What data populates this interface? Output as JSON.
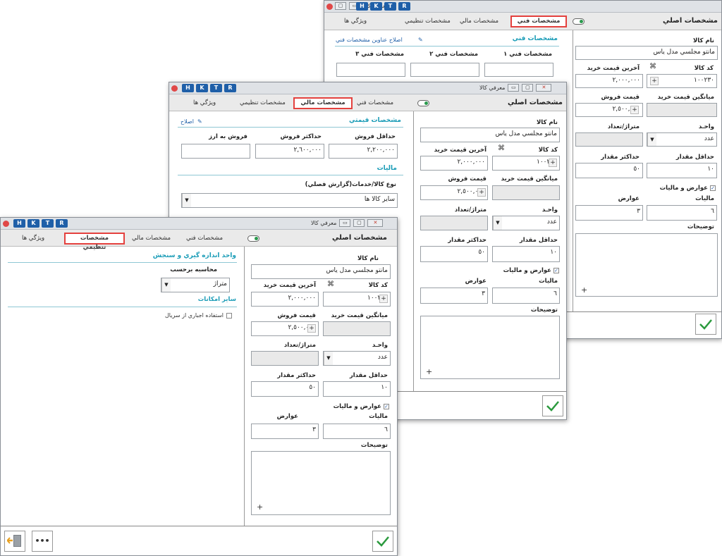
{
  "keys": [
    "H",
    "K",
    "T",
    "R"
  ],
  "title": "معرفي كالا",
  "close_glyph": "✕",
  "min_glyph": "▭",
  "max_glyph": "▢",
  "tabs": {
    "features": "ويژگي ها",
    "setup": "مشخصات تنظيمي",
    "financial": "مشخصات مالي",
    "technical": "مشخصات فني"
  },
  "main": {
    "header": "مشخصات اصلي",
    "name_label": "نام كالا",
    "name_value": "مانتو مجلسي مدل ياس",
    "code_label": "كد كالا",
    "code_value": "١٠٠٢٣٠",
    "code_icon": "⌘",
    "last_buy_label": "آخرين قيمت خريد",
    "last_buy_value": "٢,٠٠٠,٠٠٠",
    "avg_buy_label": "ميانگين قيمت خريد",
    "sell_label": "قيمت فروش",
    "sell_value": "٢,٥٠٠,٠٠٠",
    "unit_label": "واحـد",
    "unit_value": "عدد",
    "meter_label": "متراژ/تعداد",
    "min_label": "حداقل مقدار",
    "min_value": "١٠",
    "max_label": "حداكثر مقدار",
    "max_value": "٥٠",
    "tax_check": "عوارض و ماليات",
    "tax_label": "ماليات",
    "tax_value": "٦",
    "duty_label": "عوارض",
    "duty_value": "٣",
    "desc_label": "توضيحات",
    "plus": "+",
    "arrow": "▼",
    "check": "✓"
  },
  "technical": {
    "section": "مشخصات فني",
    "edit_titles": "اصلاح عناوين مشخصات فني",
    "spec1": "مشخصات فني ١",
    "spec2": "مشخصات فني ٢",
    "spec3": "مشخصات فني ٣"
  },
  "financial": {
    "section": "مشخصات قيمتي",
    "edit": "اصلاح",
    "min_sell_label": "حداقل فروش",
    "min_sell_value": "٢,٢٠٠,٠٠٠",
    "max_sell_label": "حداكثر فروش",
    "max_sell_value": "٢,٦٠٠,٠٠٠",
    "fx_label": "فروش به ارز",
    "tax_section": "ماليات",
    "goods_type_label": "نوع كالا/خدمات(گزارش فصلي)",
    "goods_type_value": "ساير كالا ها"
  },
  "setup": {
    "section": "واحد اندازه گيري و سنجش",
    "calc_label": "محاسبه برحسب",
    "calc_value": "متراژ",
    "other_section": "ساير امكانات",
    "serial_check": "استفاده اجباري از سريال"
  },
  "footer": {
    "more": "•••",
    "exit_icon": "exit-icon"
  }
}
